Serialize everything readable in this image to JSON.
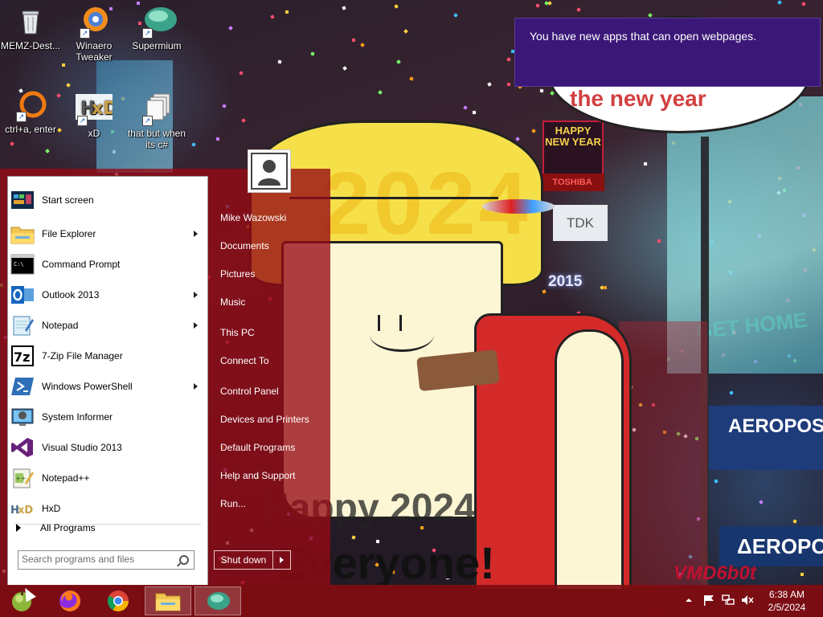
{
  "desktop": {
    "icons": [
      {
        "name": "recycle-bin-icon",
        "label": "MEMZ-Dest..."
      },
      {
        "name": "winaero-tweaker-icon",
        "label": "Winaero Tweaker"
      },
      {
        "name": "supermium-icon",
        "label": "Supermium"
      },
      {
        "name": "ctrl-a-enter-icon",
        "label": "ctrl+a, enter"
      },
      {
        "name": "xd-icon",
        "label": "xD"
      },
      {
        "name": "folder-shortcut-icon",
        "label": "that but when its c#"
      }
    ]
  },
  "wallpaper": {
    "text_1": "Happy 2024",
    "text_2": "Everyone!",
    "text_3": "2024",
    "bubble_text": "the new year",
    "sign_1": "HAPPY NEW YEAR",
    "sign_2": "TOSHIBA",
    "sign_3": "TDK",
    "sign_4": "2015",
    "sign_5": "GET HOME",
    "sign_6": "AEROPOSTALE",
    "sign_7": "ΔEROPOS",
    "signature": "VMD6b0t"
  },
  "notification": {
    "text": "You have new apps that can open webpages."
  },
  "start_menu": {
    "programs": [
      {
        "label": "Start screen",
        "has_submenu": false
      },
      {
        "label": "File Explorer",
        "has_submenu": true
      },
      {
        "label": "Command Prompt",
        "has_submenu": false
      },
      {
        "label": "Outlook 2013",
        "has_submenu": true
      },
      {
        "label": "Notepad",
        "has_submenu": true
      },
      {
        "label": "7-Zip File Manager",
        "has_submenu": false
      },
      {
        "label": "Windows PowerShell",
        "has_submenu": true
      },
      {
        "label": "System Informer",
        "has_submenu": false
      },
      {
        "label": "Visual Studio 2013",
        "has_submenu": false
      },
      {
        "label": "Notepad++",
        "has_submenu": false
      },
      {
        "label": "HxD",
        "has_submenu": false
      }
    ],
    "all_programs": "All Programs",
    "search_placeholder": "Search programs and files",
    "user_name": "Mike Wazowski",
    "places": [
      "Documents",
      "Pictures",
      "Music",
      "This PC",
      "Connect To",
      "Control Panel",
      "Devices and Printers",
      "Default Programs",
      "Help and Support",
      "Run..."
    ],
    "shutdown": "Shut down"
  },
  "taskbar": {
    "buttons": [
      "start-orb",
      "firefox",
      "chrome",
      "file-explorer",
      "supermium"
    ],
    "clock_time": "6:38 AM",
    "clock_date": "2/5/2024"
  },
  "colors": {
    "start_menu_bg": "#a0141c",
    "notification_bg": "#3b1878",
    "taskbar_bg": "#820c10"
  }
}
